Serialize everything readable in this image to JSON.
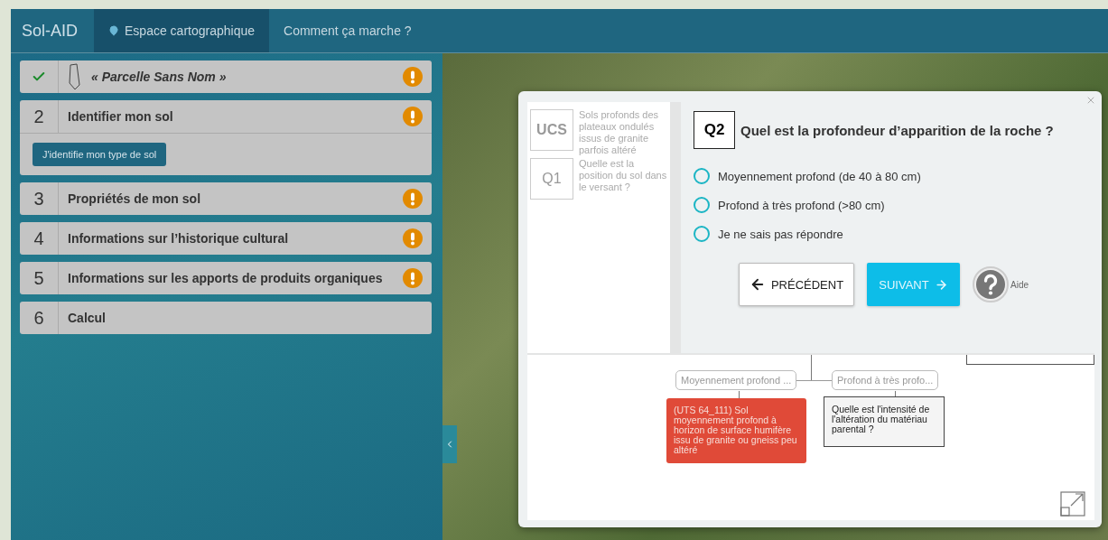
{
  "nav": {
    "brand": "Sol-AID",
    "items": [
      {
        "label": "Espace cartographique",
        "selected": true
      },
      {
        "label": "Comment ça marche ?",
        "selected": false
      }
    ]
  },
  "steps": [
    {
      "kind": "parcel",
      "done": true,
      "title": "« Parcelle Sans Nom »",
      "warning": true,
      "expanded": false
    },
    {
      "kind": "step",
      "number": "2",
      "title": "Identifier mon sol",
      "warning": true,
      "expanded": true,
      "action": "J'identifie mon type de sol"
    },
    {
      "kind": "step",
      "number": "3",
      "title": "Propriétés de mon sol",
      "warning": true,
      "expanded": false
    },
    {
      "kind": "step",
      "number": "4",
      "title": "Informations sur l’historique cultural",
      "warning": true,
      "expanded": false
    },
    {
      "kind": "step",
      "number": "5",
      "title": "Informations sur les apports de produits organiques",
      "warning": true,
      "expanded": false
    },
    {
      "kind": "step",
      "number": "6",
      "title": "Calcul",
      "warning": false,
      "expanded": false
    }
  ],
  "modal": {
    "history": [
      {
        "code": "UCS",
        "text": "Sols profonds des plateaux ondulés issus de granite parfois altéré"
      },
      {
        "code": "Q1",
        "text": "Quelle est la position du sol dans le versant ?"
      }
    ],
    "question": {
      "code": "Q2",
      "text": "Quel est la profondeur d’apparition de la roche ?"
    },
    "options": [
      {
        "label": "Moyennement profond (de 40 à 80 cm)",
        "selected": false
      },
      {
        "label": "Profond à très profond (>80 cm)",
        "selected": false
      },
      {
        "label": "Je ne sais pas répondre",
        "selected": false
      }
    ],
    "previous": "PRÉCÉDENT",
    "next": "SUIVANT",
    "help": "Aide",
    "tree": [
      {
        "label": "Moyennement profond ...",
        "node": {
          "kind": "result",
          "text": "(UTS 64_111) Sol moyennement profond à horizon de surface humifère issu de granite ou gneiss peu altéré"
        }
      },
      {
        "label": "Profond à très profo...",
        "node": {
          "kind": "question",
          "text": "Quelle est l'intensité de l'altération du matériau parental ?"
        }
      }
    ]
  }
}
